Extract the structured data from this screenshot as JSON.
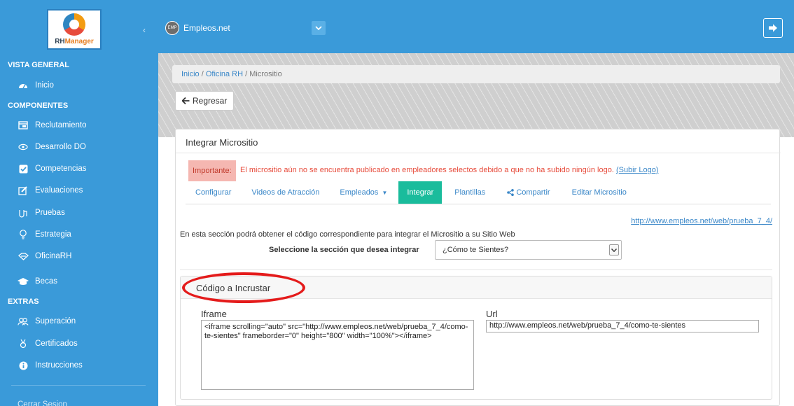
{
  "sidebar": {
    "logo_text_a": "RH",
    "logo_text_b": "Manager",
    "sections": {
      "vista_general": "VISTA GENERAL",
      "componentes": "COMPONENTES",
      "extras": "EXTRAS"
    },
    "items": [
      {
        "label": "Inicio",
        "icon": "dashboard-icon"
      },
      {
        "label": "Reclutamiento",
        "icon": "window-icon"
      },
      {
        "label": "Desarrollo DO",
        "icon": "eye-icon"
      },
      {
        "label": "Competencias",
        "icon": "checkbox-icon"
      },
      {
        "label": "Evaluaciones",
        "icon": "edit-icon"
      },
      {
        "label": "Pruebas",
        "icon": "flask-icon"
      },
      {
        "label": "Estrategia",
        "icon": "lightbulb-icon"
      },
      {
        "label": "OficinaRH",
        "icon": "handshake-icon"
      },
      {
        "label": "Becas",
        "icon": "graduation-cap-icon"
      },
      {
        "label": "Superación",
        "icon": "group-icon"
      },
      {
        "label": "Certificados",
        "icon": "certificate-icon"
      },
      {
        "label": "Instrucciones",
        "icon": "info-icon"
      }
    ],
    "bottom_item": "Cerrar Sesion"
  },
  "topbar": {
    "brand": "Empleos.net",
    "brand_badge": "EMP"
  },
  "breadcrumb": {
    "home": "Inicio",
    "section": "Oficina RH",
    "current": "Micrositio",
    "sep": "/"
  },
  "back_button": "Regresar",
  "panel": {
    "title": "Integrar Micrositio",
    "alert_label": "Importante:",
    "alert_text": "El micrositio aún no se encuentra publicado en empleadores selectos debido a que no ha subido ningún logo.",
    "alert_link": "(Subir Logo)",
    "tabs": [
      {
        "label": "Configurar",
        "active": false
      },
      {
        "label": "Videos de Atracción",
        "active": false
      },
      {
        "label": "Empleados",
        "active": false
      },
      {
        "label": "Integrar",
        "active": true
      },
      {
        "label": "Plantillas",
        "active": false
      },
      {
        "label": "Compartir",
        "active": false
      },
      {
        "label": "Editar Micrositio",
        "active": false
      }
    ],
    "site_url": "http://www.empleos.net/web/prueba_7_4/",
    "description": "En esta sección podrá obtener el código correspondiente para integrar el Micrositio a su Sitio Web",
    "select_label": "Seleccione la sección que desea integrar",
    "select_value": "¿Cómo te Sientes?",
    "embed": {
      "title": "Código a Incrustar",
      "iframe_label": "Iframe",
      "iframe_code": "<iframe scrolling=\"auto\" src=\"http://www.empleos.net/web/prueba_7_4/como-te-sientes\" frameborder=\"0\" height=\"800\" width=\"100%\"></iframe>",
      "url_label": "Url",
      "url_value": "http://www.empleos.net/web/prueba_7_4/como-te-sientes"
    }
  },
  "colors": {
    "sidebar_blue": "#3a9ad9",
    "active_tab": "#1abc9c",
    "alert_red": "#e74c3c",
    "link_blue": "#3a87c8",
    "annotation_red": "#e41b1b"
  }
}
